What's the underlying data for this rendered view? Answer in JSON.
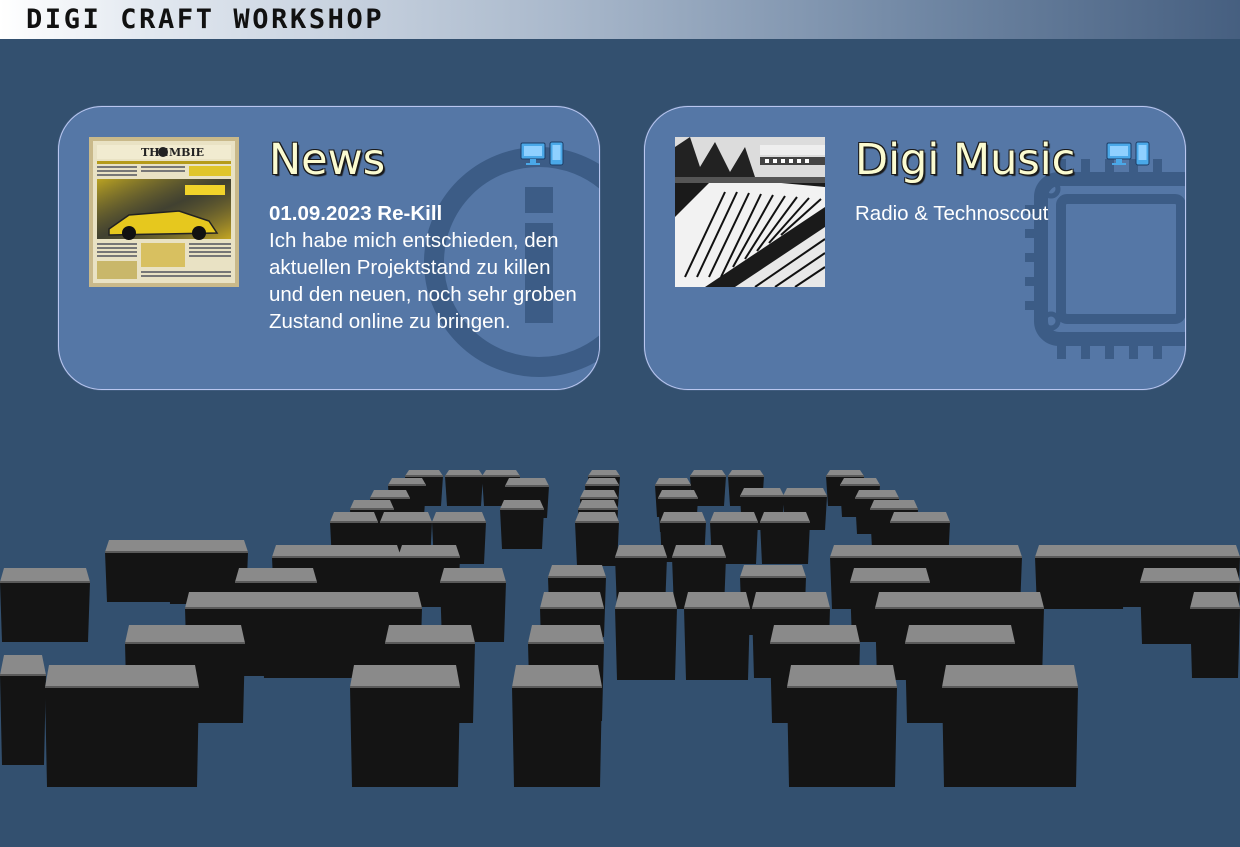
{
  "header": {
    "title": "DIGI CRAFT WORKSHOP"
  },
  "cards": [
    {
      "title": "News",
      "headline": "01.09.2023 Re-Kill",
      "body": "Ich habe mich entschieden, den aktuellen Projektstand zu killen und den neuen, noch sehr groben Zustand online zu bringen.",
      "background_icon": "info-icon",
      "thumbnail": "newspaper-thumbnail",
      "device_icon": "desktop-and-mobile-icon"
    },
    {
      "title": "Digi Music",
      "body": "Radio & Technoscout",
      "background_icon": "microchip-icon",
      "thumbnail": "synthesizer-keyboard-thumbnail",
      "device_icon": "desktop-and-mobile-icon"
    }
  ],
  "colors": {
    "background": "#33506f",
    "card": "#5577a6",
    "card_border": "#b9c6ef",
    "card_title": "#fbfbd0",
    "device_icon": "#4aa8e8"
  }
}
